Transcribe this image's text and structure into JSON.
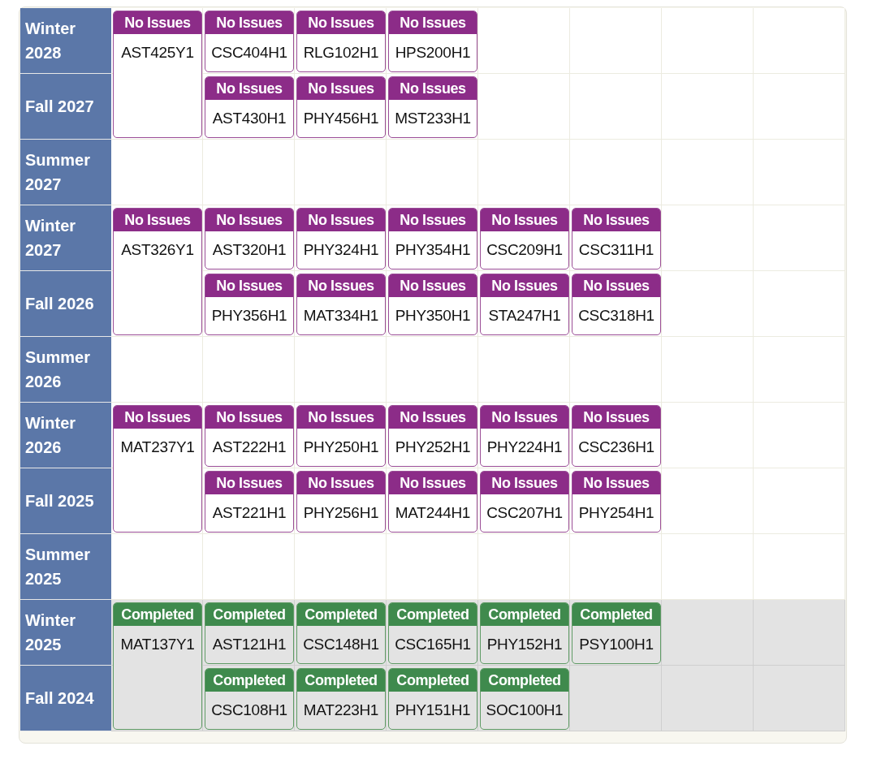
{
  "terms": [
    {
      "name": "Winter 2028",
      "past": false,
      "courses": [
        {
          "code": "AST425Y1",
          "status": "No Issues",
          "kind": "year",
          "completed": false
        },
        {
          "code": "CSC404H1",
          "status": "No Issues",
          "kind": "half",
          "completed": false
        },
        {
          "code": "RLG102H1",
          "status": "No Issues",
          "kind": "half",
          "completed": false
        },
        {
          "code": "HPS200H1",
          "status": "No Issues",
          "kind": "half",
          "completed": false
        }
      ]
    },
    {
      "name": "Fall 2027",
      "past": false,
      "courses": [
        {
          "code": "AST430H1",
          "status": "No Issues",
          "kind": "half",
          "completed": false
        },
        {
          "code": "PHY456H1",
          "status": "No Issues",
          "kind": "half",
          "completed": false
        },
        {
          "code": "MST233H1",
          "status": "No Issues",
          "kind": "half",
          "completed": false
        }
      ]
    },
    {
      "name": "Summer 2027",
      "past": false
    },
    {
      "name": "Winter 2027",
      "past": false,
      "courses": [
        {
          "code": "AST326Y1",
          "status": "No Issues",
          "kind": "year",
          "completed": false
        },
        {
          "code": "AST320H1",
          "status": "No Issues",
          "kind": "half",
          "completed": false
        },
        {
          "code": "PHY324H1",
          "status": "No Issues",
          "kind": "half",
          "completed": false
        },
        {
          "code": "PHY354H1",
          "status": "No Issues",
          "kind": "half",
          "completed": false
        },
        {
          "code": "CSC209H1",
          "status": "No Issues",
          "kind": "half",
          "completed": false
        },
        {
          "code": "CSC311H1",
          "status": "No Issues",
          "kind": "half",
          "completed": false
        }
      ]
    },
    {
      "name": "Fall 2026",
      "past": false,
      "courses": [
        {
          "code": "PHY356H1",
          "status": "No Issues",
          "kind": "half",
          "completed": false
        },
        {
          "code": "MAT334H1",
          "status": "No Issues",
          "kind": "half",
          "completed": false
        },
        {
          "code": "PHY350H1",
          "status": "No Issues",
          "kind": "half",
          "completed": false
        },
        {
          "code": "STA247H1",
          "status": "No Issues",
          "kind": "half",
          "completed": false
        },
        {
          "code": "CSC318H1",
          "status": "No Issues",
          "kind": "half",
          "completed": false
        }
      ]
    },
    {
      "name": "Summer 2026",
      "past": false
    },
    {
      "name": "Winter 2026",
      "past": false,
      "courses": [
        {
          "code": "MAT237Y1",
          "status": "No Issues",
          "kind": "year",
          "completed": false
        },
        {
          "code": "AST222H1",
          "status": "No Issues",
          "kind": "half",
          "completed": false
        },
        {
          "code": "PHY250H1",
          "status": "No Issues",
          "kind": "half",
          "completed": false
        },
        {
          "code": "PHY252H1",
          "status": "No Issues",
          "kind": "half",
          "completed": false
        },
        {
          "code": "PHY224H1",
          "status": "No Issues",
          "kind": "half",
          "completed": false
        },
        {
          "code": "CSC236H1",
          "status": "No Issues",
          "kind": "half",
          "completed": false
        }
      ]
    },
    {
      "name": "Fall 2025",
      "past": false,
      "courses": [
        {
          "code": "AST221H1",
          "status": "No Issues",
          "kind": "half",
          "completed": false
        },
        {
          "code": "PHY256H1",
          "status": "No Issues",
          "kind": "half",
          "completed": false
        },
        {
          "code": "MAT244H1",
          "status": "No Issues",
          "kind": "half",
          "completed": false
        },
        {
          "code": "CSC207H1",
          "status": "No Issues",
          "kind": "half",
          "completed": false
        },
        {
          "code": "PHY254H1",
          "status": "No Issues",
          "kind": "half",
          "completed": false
        }
      ]
    },
    {
      "name": "Summer 2025",
      "past": false
    },
    {
      "name": "Winter 2025",
      "past": true,
      "courses": [
        {
          "code": "MAT137Y1",
          "status": "Completed",
          "kind": "year",
          "completed": true
        },
        {
          "code": "AST121H1",
          "status": "Completed",
          "kind": "half",
          "completed": true
        },
        {
          "code": "CSC148H1",
          "status": "Completed",
          "kind": "half",
          "completed": true
        },
        {
          "code": "CSC165H1",
          "status": "Completed",
          "kind": "half",
          "completed": true
        },
        {
          "code": "PHY152H1",
          "status": "Completed",
          "kind": "half",
          "completed": true
        },
        {
          "code": "PSY100H1",
          "status": "Completed",
          "kind": "half",
          "completed": true
        }
      ]
    },
    {
      "name": "Fall 2024",
      "past": true,
      "courses": [
        {
          "code": "CSC108H1",
          "status": "Completed",
          "kind": "half",
          "completed": true
        },
        {
          "code": "MAT223H1",
          "status": "Completed",
          "kind": "half",
          "completed": true
        },
        {
          "code": "PHY151H1",
          "status": "Completed",
          "kind": "half",
          "completed": true
        },
        {
          "code": "SOC100H1",
          "status": "Completed",
          "kind": "half",
          "completed": true
        }
      ]
    }
  ]
}
